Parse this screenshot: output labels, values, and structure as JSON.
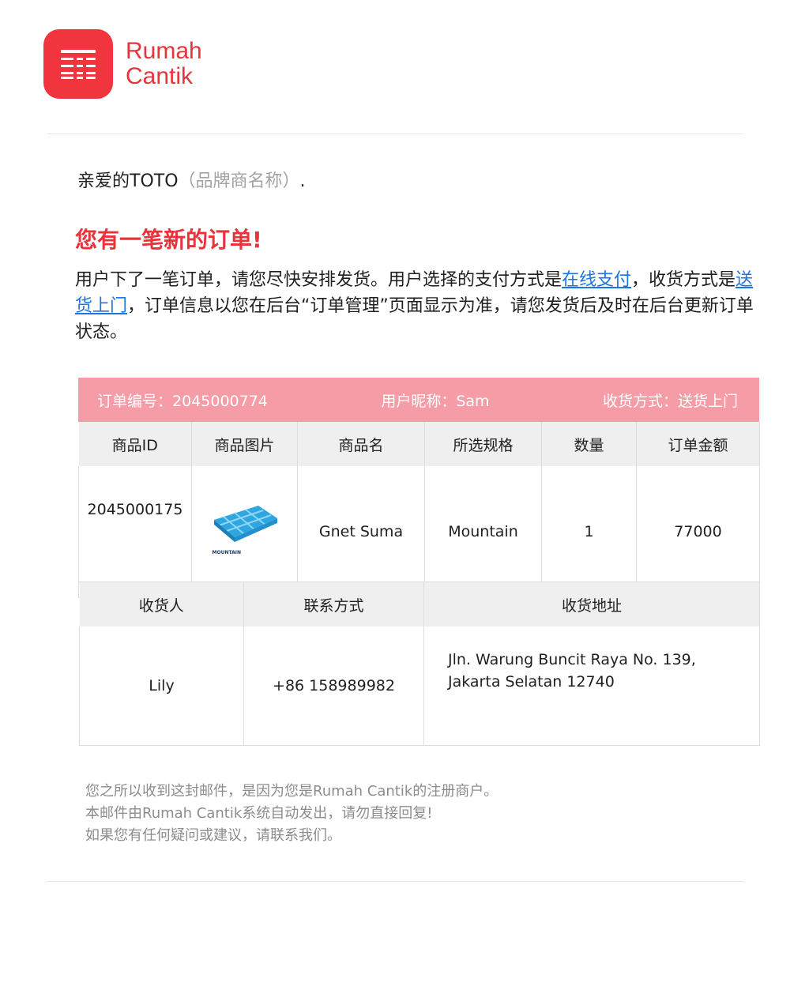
{
  "brand": {
    "name_line1": "Rumah",
    "name_line2": "Cantik",
    "accent_color": "#e8333b",
    "icon": "rumah-cantik-logo-icon"
  },
  "greeting": {
    "salutation": "亲爱的TOTO",
    "brand_note": "（品牌商名称）",
    "trailing": "."
  },
  "headline": "您有一笔新的订单!",
  "message": {
    "part1": "用户下了一笔订单，请您尽快安排发货。用户选择的支付方式是",
    "payment_link": "在线支付",
    "part2": "，收货方式是",
    "delivery_link": "送货上门",
    "part3": "，订单信息以您在后台“订单管理”页面显示为准，请您发货后及时在后台更新订单状态。"
  },
  "order": {
    "order_no": "订单编号：2045000774",
    "nickname": "用户昵称：Sam",
    "delivery": "收货方式：送货上门",
    "headers": [
      "商品ID",
      "商品图片",
      "商品名",
      "所选规格",
      "数量",
      "订单金额"
    ],
    "items": [
      {
        "id": "2045000175",
        "image_icon": "roof-tile-product-image",
        "image_caption": "MOUNTAIN",
        "name": "Gnet Suma",
        "spec": "Mountain",
        "qty": "1",
        "amount": "77000"
      }
    ]
  },
  "shipping": {
    "headers": [
      "收货人",
      "联系方式",
      "收货地址"
    ],
    "recipient": "Lily",
    "phone": "+86 158989982",
    "address_line1": "Jln. Warung Buncit Raya No. 139,",
    "address_line2": "Jakarta Selatan 12740"
  },
  "footer": {
    "line1": "您之所以收到这封邮件，是因为您是Rumah Cantik的注册商户。",
    "line2": "本邮件由Rumah Cantik系统自动发出，请勿直接回复!",
    "line3": "如果您有任何疑问或建议，请联系我们。"
  }
}
